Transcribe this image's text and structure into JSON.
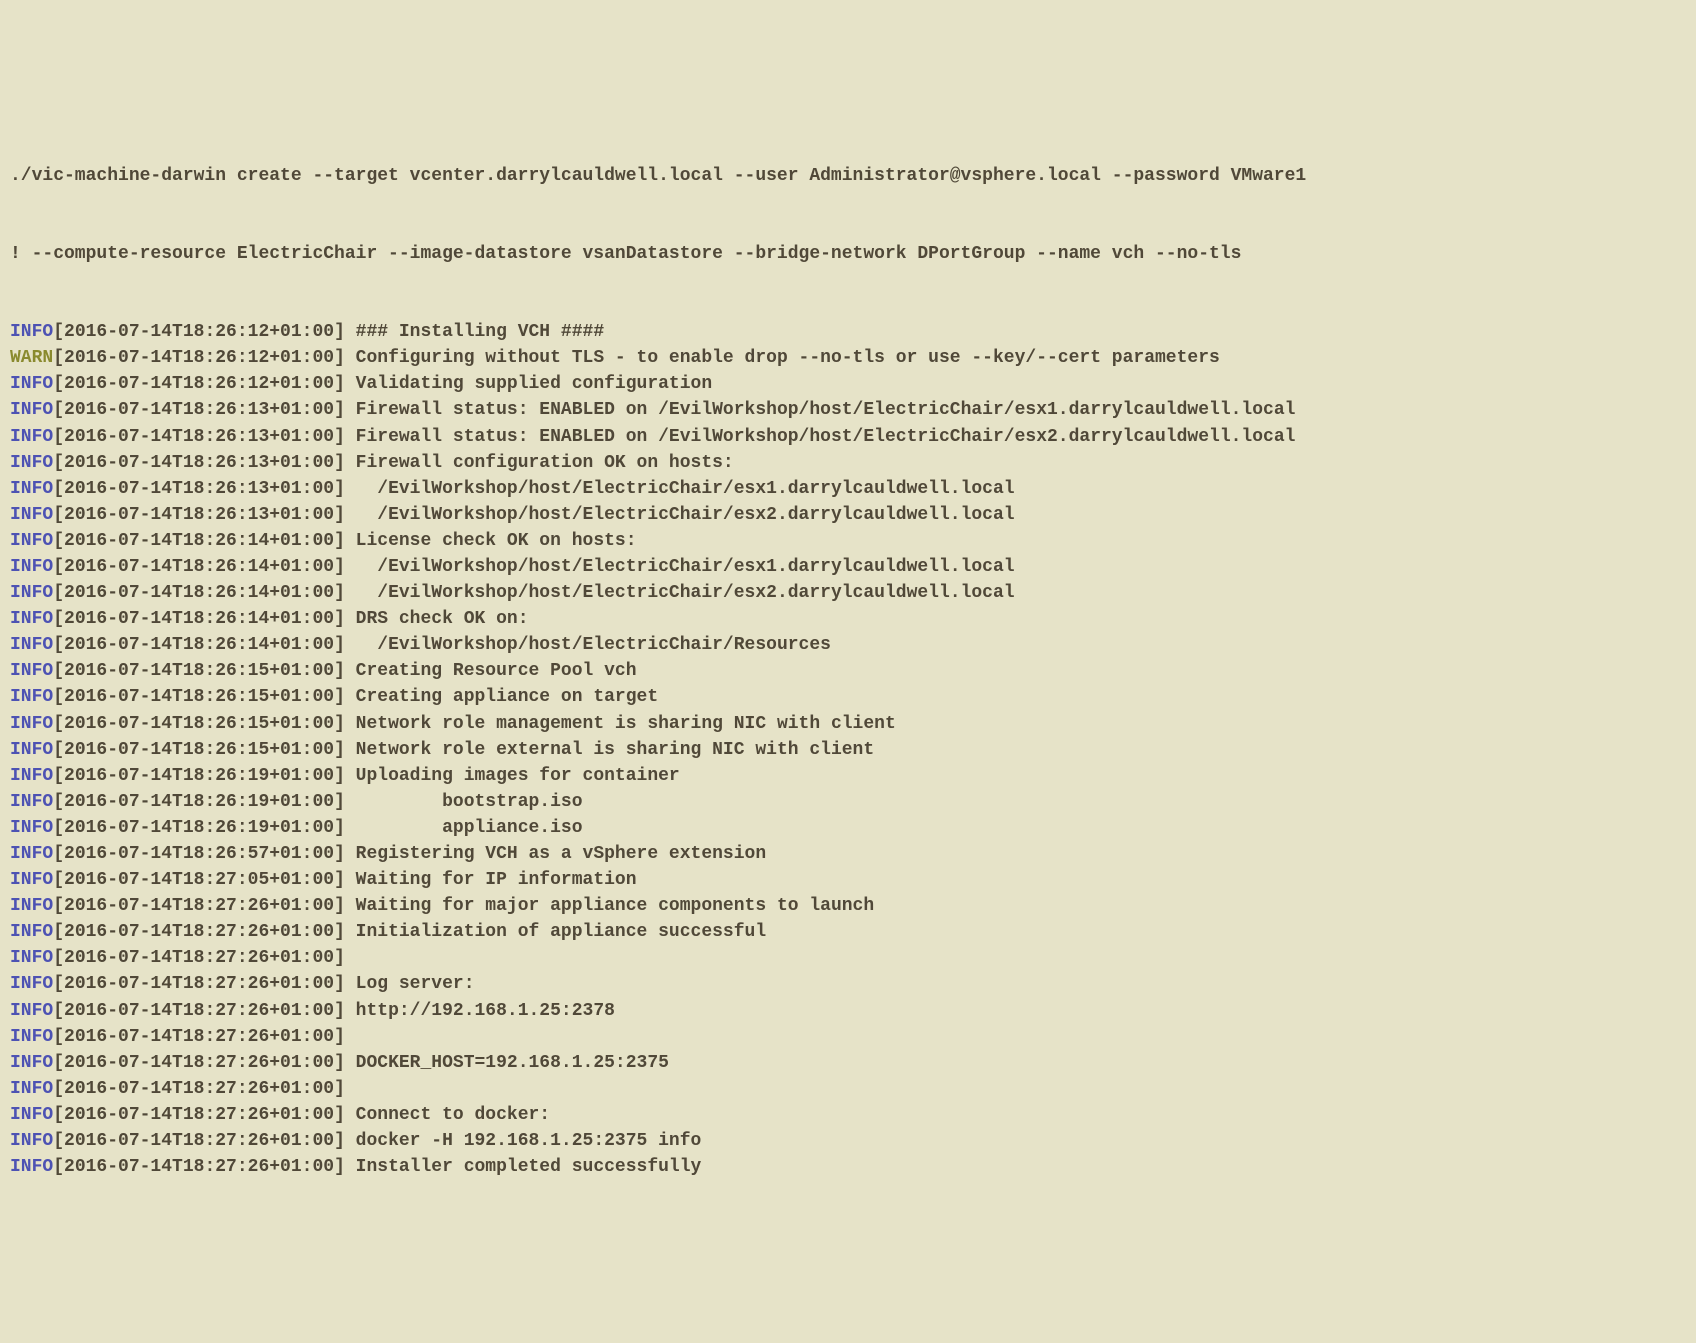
{
  "command_lines": [
    "./vic-machine-darwin create --target vcenter.darrylcauldwell.local --user Administrator@vsphere.local --password VMware1",
    "! --compute-resource ElectricChair --image-datastore vsanDatastore --bridge-network DPortGroup --name vch --no-tls"
  ],
  "log_lines": [
    {
      "level": "INFO",
      "ts": "[2016-07-14T18:26:12+01:00]",
      "msg": " ### Installing VCH ####"
    },
    {
      "level": "WARN",
      "ts": "[2016-07-14T18:26:12+01:00]",
      "msg": " Configuring without TLS - to enable drop --no-tls or use --key/--cert parameters"
    },
    {
      "level": "INFO",
      "ts": "[2016-07-14T18:26:12+01:00]",
      "msg": " Validating supplied configuration"
    },
    {
      "level": "INFO",
      "ts": "[2016-07-14T18:26:13+01:00]",
      "msg": " Firewall status: ENABLED on /EvilWorkshop/host/ElectricChair/esx1.darrylcauldwell.local"
    },
    {
      "level": "INFO",
      "ts": "[2016-07-14T18:26:13+01:00]",
      "msg": " Firewall status: ENABLED on /EvilWorkshop/host/ElectricChair/esx2.darrylcauldwell.local"
    },
    {
      "level": "INFO",
      "ts": "[2016-07-14T18:26:13+01:00]",
      "msg": " Firewall configuration OK on hosts:"
    },
    {
      "level": "INFO",
      "ts": "[2016-07-14T18:26:13+01:00]",
      "msg": "   /EvilWorkshop/host/ElectricChair/esx1.darrylcauldwell.local"
    },
    {
      "level": "INFO",
      "ts": "[2016-07-14T18:26:13+01:00]",
      "msg": "   /EvilWorkshop/host/ElectricChair/esx2.darrylcauldwell.local"
    },
    {
      "level": "INFO",
      "ts": "[2016-07-14T18:26:14+01:00]",
      "msg": " License check OK on hosts:"
    },
    {
      "level": "INFO",
      "ts": "[2016-07-14T18:26:14+01:00]",
      "msg": "   /EvilWorkshop/host/ElectricChair/esx1.darrylcauldwell.local"
    },
    {
      "level": "INFO",
      "ts": "[2016-07-14T18:26:14+01:00]",
      "msg": "   /EvilWorkshop/host/ElectricChair/esx2.darrylcauldwell.local"
    },
    {
      "level": "INFO",
      "ts": "[2016-07-14T18:26:14+01:00]",
      "msg": " DRS check OK on:"
    },
    {
      "level": "INFO",
      "ts": "[2016-07-14T18:26:14+01:00]",
      "msg": "   /EvilWorkshop/host/ElectricChair/Resources"
    },
    {
      "level": "INFO",
      "ts": "[2016-07-14T18:26:15+01:00]",
      "msg": " Creating Resource Pool vch"
    },
    {
      "level": "INFO",
      "ts": "[2016-07-14T18:26:15+01:00]",
      "msg": " Creating appliance on target"
    },
    {
      "level": "INFO",
      "ts": "[2016-07-14T18:26:15+01:00]",
      "msg": " Network role management is sharing NIC with client"
    },
    {
      "level": "INFO",
      "ts": "[2016-07-14T18:26:15+01:00]",
      "msg": " Network role external is sharing NIC with client"
    },
    {
      "level": "INFO",
      "ts": "[2016-07-14T18:26:19+01:00]",
      "msg": " Uploading images for container"
    },
    {
      "level": "INFO",
      "ts": "[2016-07-14T18:26:19+01:00]",
      "msg": "         bootstrap.iso"
    },
    {
      "level": "INFO",
      "ts": "[2016-07-14T18:26:19+01:00]",
      "msg": "         appliance.iso"
    },
    {
      "level": "INFO",
      "ts": "[2016-07-14T18:26:57+01:00]",
      "msg": " Registering VCH as a vSphere extension"
    },
    {
      "level": "INFO",
      "ts": "[2016-07-14T18:27:05+01:00]",
      "msg": " Waiting for IP information"
    },
    {
      "level": "INFO",
      "ts": "[2016-07-14T18:27:26+01:00]",
      "msg": " Waiting for major appliance components to launch"
    },
    {
      "level": "INFO",
      "ts": "[2016-07-14T18:27:26+01:00]",
      "msg": " Initialization of appliance successful"
    },
    {
      "level": "INFO",
      "ts": "[2016-07-14T18:27:26+01:00]",
      "msg": ""
    },
    {
      "level": "INFO",
      "ts": "[2016-07-14T18:27:26+01:00]",
      "msg": " Log server:"
    },
    {
      "level": "INFO",
      "ts": "[2016-07-14T18:27:26+01:00]",
      "msg": " http://192.168.1.25:2378"
    },
    {
      "level": "INFO",
      "ts": "[2016-07-14T18:27:26+01:00]",
      "msg": ""
    },
    {
      "level": "INFO",
      "ts": "[2016-07-14T18:27:26+01:00]",
      "msg": " DOCKER_HOST=192.168.1.25:2375"
    },
    {
      "level": "INFO",
      "ts": "[2016-07-14T18:27:26+01:00]",
      "msg": ""
    },
    {
      "level": "INFO",
      "ts": "[2016-07-14T18:27:26+01:00]",
      "msg": " Connect to docker:"
    },
    {
      "level": "INFO",
      "ts": "[2016-07-14T18:27:26+01:00]",
      "msg": " docker -H 192.168.1.25:2375 info"
    },
    {
      "level": "INFO",
      "ts": "[2016-07-14T18:27:26+01:00]",
      "msg": " Installer completed successfully"
    }
  ]
}
